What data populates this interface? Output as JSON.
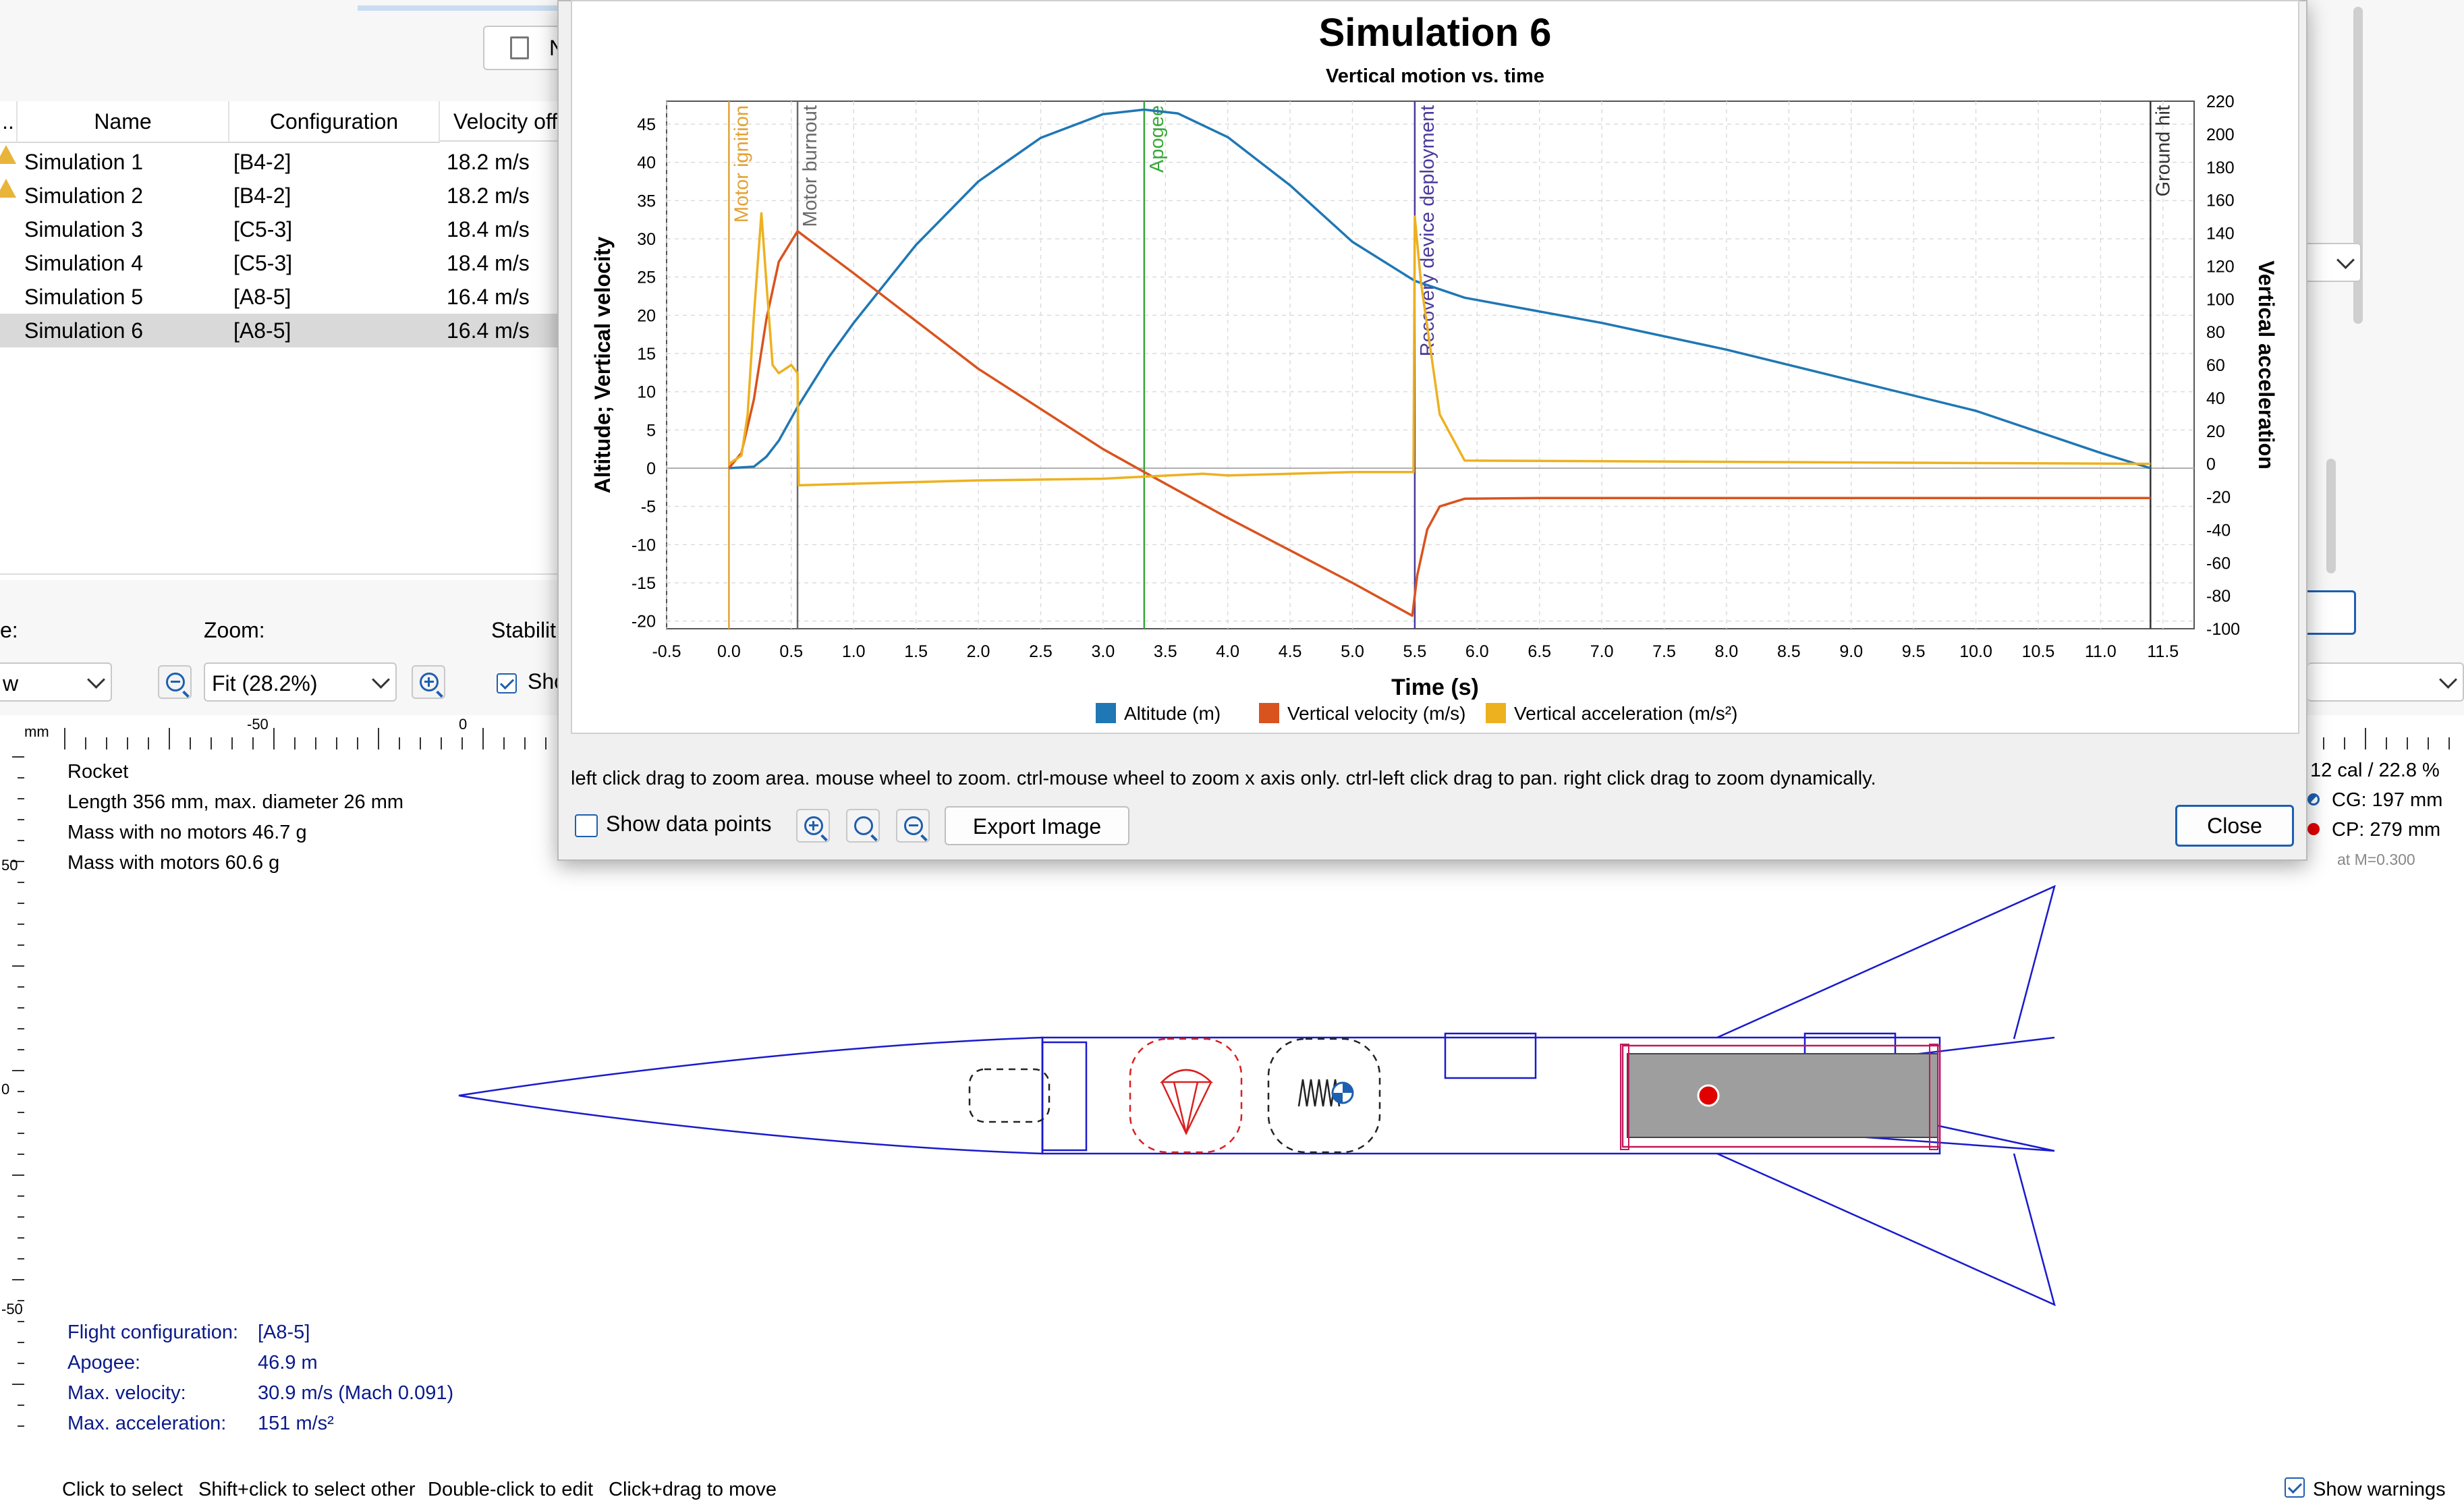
{
  "background": {
    "toolbar_new_button": "N",
    "table": {
      "columns": [
        "..",
        "Name",
        "Configuration",
        "Velocity off"
      ],
      "rows": [
        {
          "name": "Simulation 1",
          "config": "[B4-2]",
          "velocity": "18.2 m/s",
          "warning": true
        },
        {
          "name": "Simulation 2",
          "config": "[B4-2]",
          "velocity": "18.2 m/s",
          "warning": true
        },
        {
          "name": "Simulation 3",
          "config": "[C5-3]",
          "velocity": "18.4 m/s",
          "warning": false
        },
        {
          "name": "Simulation 4",
          "config": "[C5-3]",
          "velocity": "18.4 m/s",
          "warning": false
        },
        {
          "name": "Simulation 5",
          "config": "[A8-5]",
          "velocity": "16.4 m/s",
          "warning": false
        },
        {
          "name": "Simulation 6",
          "config": "[A8-5]",
          "velocity": "16.4 m/s",
          "warning": false,
          "selected": true
        }
      ]
    },
    "controls": {
      "view_label": "e:",
      "view_value": "w",
      "zoom_label": "Zoom:",
      "zoom_value": "Fit (28.2%)",
      "stability_label": "Stabilit",
      "show_label": "Sho"
    },
    "ruler": {
      "unit": "mm",
      "top_ticks": [
        "-50",
        "0"
      ],
      "left_ticks": [
        "50",
        "0",
        "-50"
      ]
    },
    "rocket_info": [
      "Rocket",
      "Length 356 mm, max. diameter 26 mm",
      "Mass with no motors 46.7 g",
      "Mass with motors 60.6 g"
    ],
    "stability": {
      "cal": "12 cal / 22.8 %",
      "cg": "CG: 197 mm",
      "cp": "CP: 279 mm",
      "mach": "at M=0.300"
    },
    "sim_info": {
      "flight_config_label": "Flight configuration:",
      "flight_config_value": "[A8-5]",
      "apogee_label": "Apogee:",
      "apogee_value": "46.9 m",
      "max_velocity_label": "Max. velocity:",
      "max_velocity_value": "30.9 m/s  (Mach 0.091)",
      "max_accel_label": "Max. acceleration:",
      "max_accel_value": "151 m/s²"
    },
    "status_bar": {
      "hints": [
        "Click to select",
        "Shift+click to select other",
        "Double-click to edit",
        "Click+drag to move"
      ],
      "show_warnings": "Show warnings"
    },
    "colors": {
      "rocket_outline": "#1a1acc",
      "parachute": "#d92020",
      "motor_fill": "#9e9e9e",
      "cp_marker": "#e00000",
      "cg_marker": "#1d5fb0"
    }
  },
  "dialog": {
    "hint": "left click drag to zoom area. mouse wheel to zoom. ctrl-mouse wheel to zoom x axis only. ctrl-left click drag to pan.  right click drag to zoom dynamically.",
    "show_data_points": "Show data points",
    "export_button": "Export Image",
    "close_button": "Close"
  },
  "chart_data": {
    "type": "line",
    "title": "Simulation 6",
    "subtitle": "Vertical motion vs. time",
    "xlabel": "Time (s)",
    "ylabel": "Altitude; Vertical velocity",
    "y2label": "Vertical acceleration",
    "xlim": [
      -0.5,
      11.75
    ],
    "ylim": [
      -21,
      48
    ],
    "y2lim": [
      -100,
      220
    ],
    "x_ticks": [
      "-0.5",
      "0.0",
      "0.5",
      "1.0",
      "1.5",
      "2.0",
      "2.5",
      "3.0",
      "3.5",
      "4.0",
      "4.5",
      "5.0",
      "5.5",
      "6.0",
      "6.5",
      "7.0",
      "7.5",
      "8.0",
      "8.5",
      "9.0",
      "9.5",
      "10.0",
      "10.5",
      "11.0",
      "11.5"
    ],
    "y_ticks": [
      "-20",
      "-15",
      "-10",
      "-5",
      "0",
      "5",
      "10",
      "15",
      "20",
      "25",
      "30",
      "35",
      "40",
      "45"
    ],
    "y2_ticks": [
      "-100",
      "-80",
      "-60",
      "-40",
      "-20",
      "0",
      "20",
      "40",
      "60",
      "80",
      "100",
      "120",
      "140",
      "160",
      "180",
      "200",
      "220"
    ],
    "grid": true,
    "legend_position": "bottom",
    "events": [
      {
        "name": "Motor ignition",
        "x": 0.0,
        "color": "#e2a233"
      },
      {
        "name": "Motor burnout",
        "x": 0.55,
        "color": "#6a6a6a"
      },
      {
        "name": "Apogee",
        "x": 3.33,
        "color": "#38a838"
      },
      {
        "name": "Recovery device deployment",
        "x": 5.5,
        "color": "#4a3a9a"
      },
      {
        "name": "Ground hit",
        "x": 11.4,
        "color": "#333333"
      }
    ],
    "series": [
      {
        "name": "Altitude (m)",
        "axis": "left",
        "color": "#1f77b4",
        "x": [
          0,
          0.2,
          0.3,
          0.4,
          0.55,
          0.8,
          1.0,
          1.5,
          2.0,
          2.5,
          3.0,
          3.33,
          3.6,
          4.0,
          4.5,
          5.0,
          5.5,
          5.9,
          7,
          8,
          9,
          10,
          11,
          11.4
        ],
        "y": [
          0,
          0.2,
          1.5,
          3.6,
          8,
          14.5,
          19,
          29.2,
          37.5,
          43.2,
          46.3,
          46.9,
          46.4,
          43.3,
          37,
          29.6,
          24.5,
          22.3,
          19,
          15.5,
          11.5,
          7.5,
          2,
          0
        ]
      },
      {
        "name": "Vertical velocity (m/s)",
        "axis": "left",
        "color": "#d9531e",
        "x": [
          0,
          0.1,
          0.2,
          0.3,
          0.4,
          0.55,
          1.0,
          2.0,
          3.0,
          3.33,
          4.0,
          5.0,
          5.48,
          5.52,
          5.6,
          5.7,
          5.9,
          6.5,
          11.4
        ],
        "y": [
          0,
          2,
          9,
          19.5,
          27,
          31,
          25.5,
          13,
          2.5,
          -0.5,
          -6.5,
          -15,
          -19.3,
          -14,
          -8,
          -5,
          -4,
          -3.9,
          -3.9
        ]
      },
      {
        "name": "Vertical acceleration (m/s²)",
        "axis": "right",
        "color": "#edb120",
        "x": [
          0,
          0.1,
          0.15,
          0.2,
          0.26,
          0.3,
          0.35,
          0.4,
          0.5,
          0.55,
          0.56,
          1.0,
          2.0,
          3.0,
          3.8,
          4.0,
          4.5,
          5.0,
          5.49,
          5.5,
          5.55,
          5.7,
          5.9,
          11.4
        ],
        "y": [
          0,
          5,
          30,
          90,
          152,
          110,
          60,
          55,
          60,
          55,
          -13,
          -12,
          -10,
          -9,
          -6,
          -7,
          -6,
          -5,
          -5,
          150,
          110,
          30,
          2,
          0
        ]
      }
    ]
  }
}
